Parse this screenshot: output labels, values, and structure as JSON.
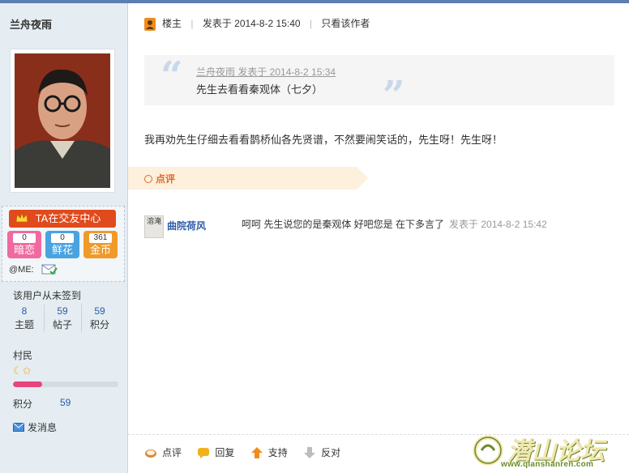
{
  "author": {
    "name": "兰舟夜雨",
    "ta_button": "TA在交友中心",
    "stats": [
      {
        "num": "0",
        "label": "暗恋"
      },
      {
        "num": "0",
        "label": "鲜花"
      },
      {
        "num": "361",
        "label": "金币"
      }
    ],
    "me_label": "@ME:",
    "signin": "该用户从未签到",
    "counts": [
      {
        "num": "8",
        "label": "主题"
      },
      {
        "num": "59",
        "label": "帖子"
      },
      {
        "num": "59",
        "label": "积分"
      }
    ],
    "rank": "村民",
    "level_progress": 0.28,
    "score_label": "积分",
    "score_value": "59",
    "send_message": "发消息"
  },
  "post": {
    "floor": "楼主",
    "posted": "发表于 2014-8-2 15:40",
    "only_author": "只看该作者",
    "quote_meta": "兰舟夜雨 发表于 2014-8-2 15:34",
    "quote_text": "先生去看看秦观体（七夕）",
    "content": "我再劝先生仔细去看看鹊桥仙各先贤谱，不然要闹笑话的，先生呀！先生呀！",
    "comment_label": "点评"
  },
  "reply": {
    "user": "曲院荷风",
    "avatar_text": "溶淹",
    "text": "呵呵 先生说您的是秦观体 好吧您是 在下多言了",
    "time": "发表于 2014-8-2 15:42"
  },
  "actions": [
    {
      "label": "点评",
      "icon": "comment-icon"
    },
    {
      "label": "回复",
      "icon": "reply-icon"
    },
    {
      "label": "支持",
      "icon": "thumb-up-arrow-icon"
    },
    {
      "label": "反对",
      "icon": "thumb-down-arrow-icon"
    }
  ],
  "watermark": {
    "text": "潜山论坛",
    "url": "www.qianshanren.com"
  },
  "colors": {
    "sidebar_bg": "#e5edf2",
    "link_blue": "#2b5ba8",
    "ta_button": "#e04a1c",
    "stat_pink": "#f06aa0",
    "stat_blue": "#4aa3e0",
    "stat_orange": "#f09a2a",
    "comment_orange": "#e06a2c"
  }
}
